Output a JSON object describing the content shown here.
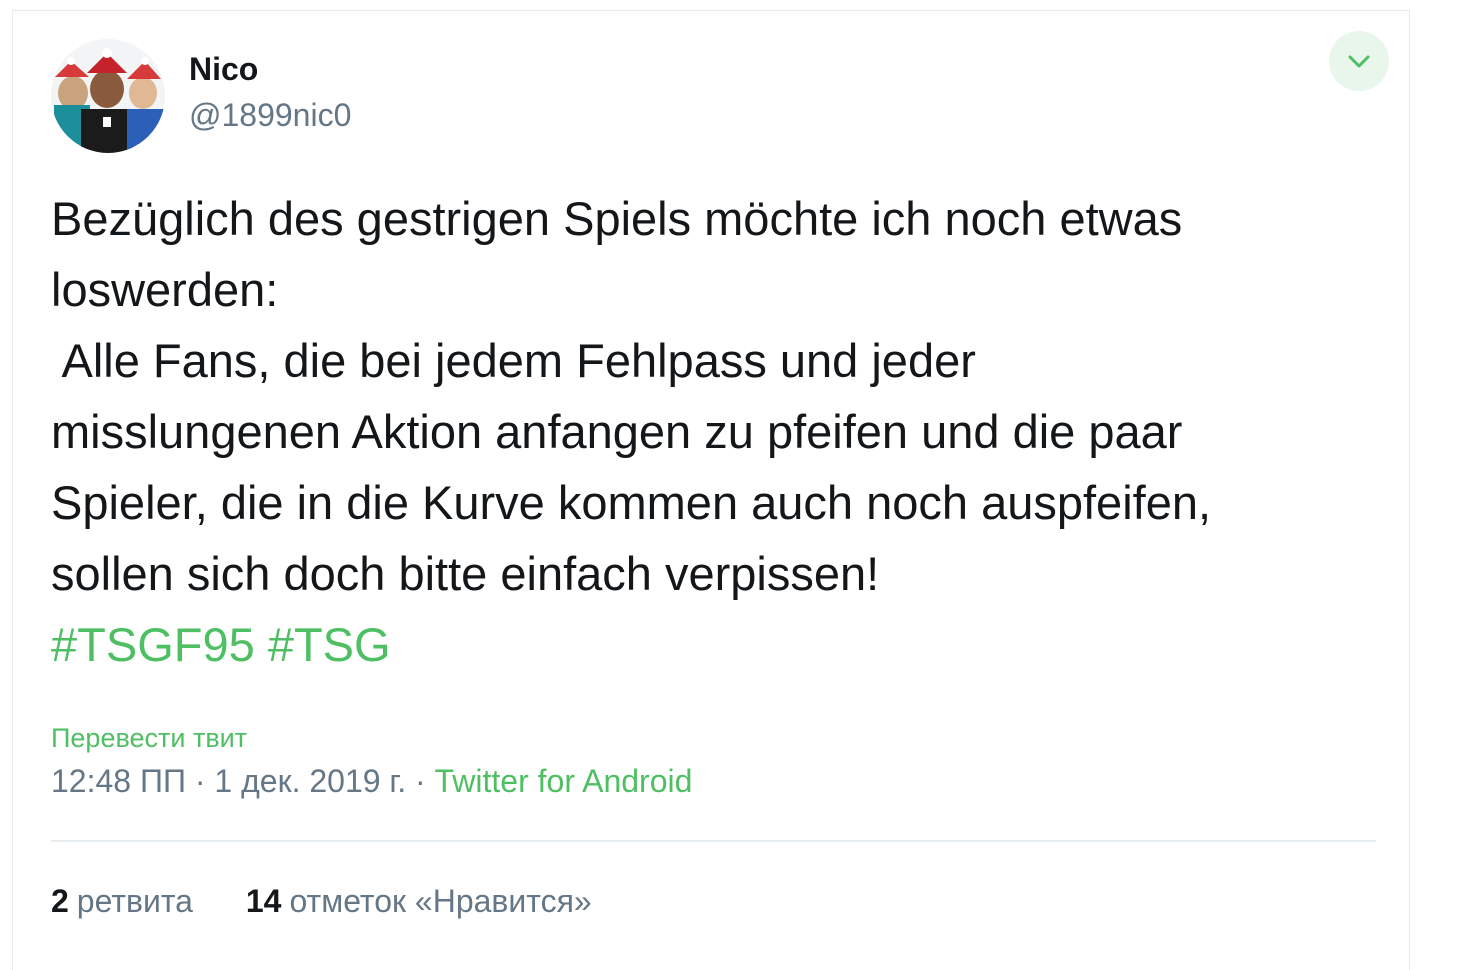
{
  "author": {
    "name": "Nico",
    "handle": "@1899nic0",
    "avatar_icon": "profile-photo"
  },
  "tweet": {
    "text_lines": [
      "Bezüglich des gestrigen Spiels möchte ich noch etwas",
      "loswerden:",
      " Alle Fans, die bei jedem Fehlpass und jeder",
      "misslungenen Aktion anfangen zu pfeifen und die paar",
      "Spieler, die in die Kurve kommen auch noch auspfeifen,",
      "sollen sich doch bitte einfach verpissen!"
    ],
    "hashtags": [
      "#TSGF95",
      "#TSG"
    ],
    "translate_label": "Перевести твит",
    "time": "12:48 ПП",
    "date": "1 дек. 2019 г.",
    "separator": "·",
    "source": "Twitter for Android"
  },
  "stats": {
    "retweets_count": "2",
    "retweets_label": "ретвита",
    "likes_count": "14",
    "likes_label": "отметок «Нравится»"
  },
  "colors": {
    "accent": "#4fbf63",
    "caret_bg": "#e8f6ec",
    "text": "#14171a",
    "secondary": "#657786"
  }
}
